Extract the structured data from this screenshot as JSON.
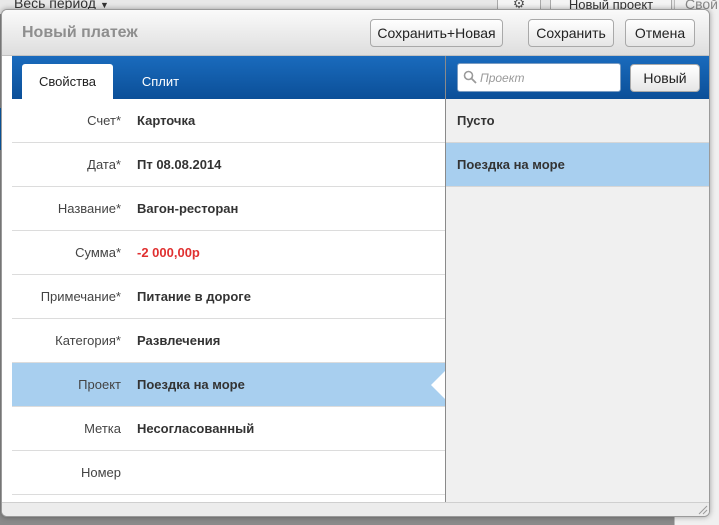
{
  "background": {
    "period_label": "Весь период",
    "new_project_label": "Новый проект",
    "right_cut_text": "Свой"
  },
  "dialog": {
    "title": "Новый платеж",
    "buttons": {
      "save_new": "Сохранить+Новая",
      "save": "Сохранить",
      "cancel": "Отмена"
    }
  },
  "tabs": [
    {
      "label": "Свойства",
      "active": true
    },
    {
      "label": "Сплит",
      "active": false
    }
  ],
  "fields": [
    {
      "label": "Счет*",
      "value": "Карточка"
    },
    {
      "label": "Дата*",
      "value": "Пт 08.08.2014"
    },
    {
      "label": "Название*",
      "value": "Вагон-ресторан"
    },
    {
      "label": "Сумма*",
      "value": "-2 000,00р",
      "color": "#e03030"
    },
    {
      "label": "Примечание*",
      "value": "Питание в дороге"
    },
    {
      "label": "Категория*",
      "value": "Развлечения"
    },
    {
      "label": "Проект",
      "value": "Поездка на море",
      "selected": true
    },
    {
      "label": "Метка",
      "value": "Несогласованный"
    },
    {
      "label": "Номер",
      "value": ""
    }
  ],
  "project_panel": {
    "search_placeholder": "Проект",
    "new_button": "Новый",
    "items": [
      {
        "label": "Пусто",
        "selected": false
      },
      {
        "label": "Поездка на море",
        "selected": true
      }
    ]
  },
  "colors": {
    "accent_blue": "#0b5fad",
    "selection": "#a8cfef",
    "negative_amount": "#e03030"
  }
}
